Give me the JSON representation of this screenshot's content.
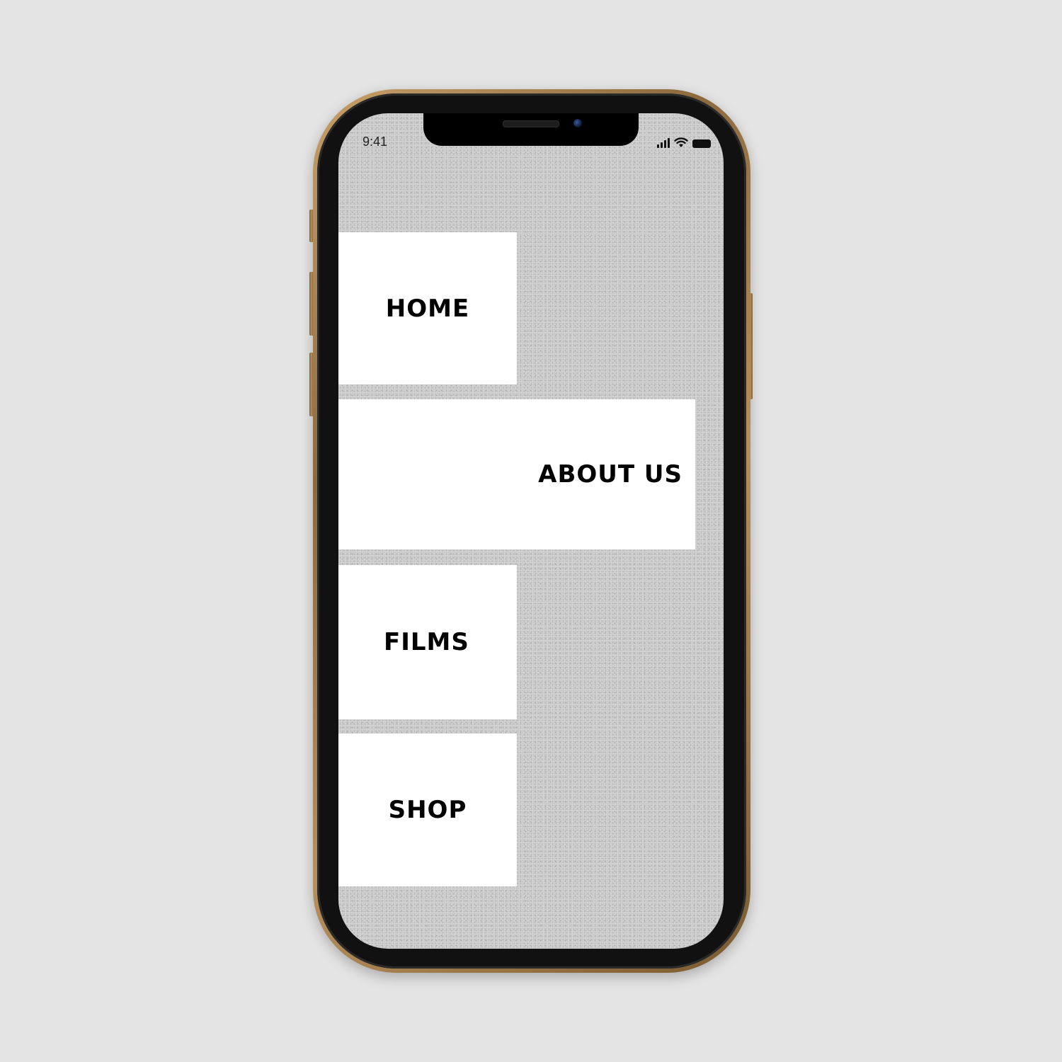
{
  "status_bar": {
    "time": "9:41",
    "icons": [
      "signal-icon",
      "wifi-icon",
      "battery-icon"
    ]
  },
  "menu": {
    "items": [
      {
        "label": "HOME"
      },
      {
        "label": "ABOUT US"
      },
      {
        "label": "FILMS"
      },
      {
        "label": "SHOP"
      }
    ]
  },
  "colors": {
    "background": "#e4e4e4",
    "phone_frame": "#b78f5c",
    "menu_block": "#ffffff",
    "menu_text": "#000000"
  }
}
